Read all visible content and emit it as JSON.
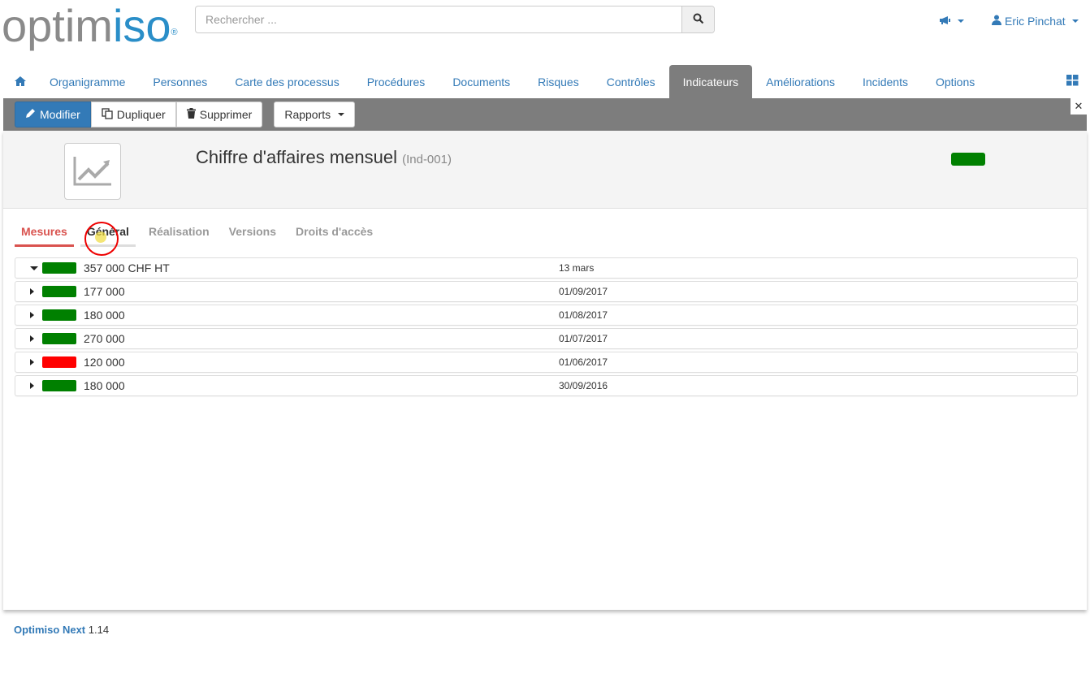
{
  "header": {
    "logo_gray": "optim",
    "logo_accent": "iso",
    "logo_reg": "®",
    "search_placeholder": "Rechercher ...",
    "user_name": "Eric Pinchat"
  },
  "nav": {
    "items": [
      {
        "label": "Organigramme"
      },
      {
        "label": "Personnes"
      },
      {
        "label": "Carte des processus"
      },
      {
        "label": "Procédures"
      },
      {
        "label": "Documents"
      },
      {
        "label": "Risques"
      },
      {
        "label": "Contrôles"
      },
      {
        "label": "Indicateurs"
      },
      {
        "label": "Améliorations"
      },
      {
        "label": "Incidents"
      },
      {
        "label": "Options"
      }
    ],
    "active_index": 7
  },
  "toolbar": {
    "edit_label": "Modifier",
    "duplicate_label": "Dupliquer",
    "delete_label": "Supprimer",
    "reports_label": "Rapports"
  },
  "indicator": {
    "title": "Chiffre d'affaires mensuel",
    "code": "(Ind-001)",
    "status_color": "#008000"
  },
  "tabs": [
    {
      "label": "Mesures"
    },
    {
      "label": "Général"
    },
    {
      "label": "Réalisation"
    },
    {
      "label": "Versions"
    },
    {
      "label": "Droits d'accès"
    }
  ],
  "measures": [
    {
      "value": "357 000 CHF HT",
      "date": "13 mars",
      "status_color": "#008000",
      "expanded": true
    },
    {
      "value": "177 000",
      "date": "01/09/2017",
      "status_color": "#008000",
      "expanded": false
    },
    {
      "value": "180 000",
      "date": "01/08/2017",
      "status_color": "#008000",
      "expanded": false
    },
    {
      "value": "270 000",
      "date": "01/07/2017",
      "status_color": "#008000",
      "expanded": false
    },
    {
      "value": "120 000",
      "date": "01/06/2017",
      "status_color": "#ff0000",
      "expanded": false
    },
    {
      "value": "180 000",
      "date": "30/09/2016",
      "status_color": "#008000",
      "expanded": false
    }
  ],
  "footer": {
    "brand": "Optimiso Next",
    "version": "1.14"
  },
  "colors": {
    "accent": "#337ab7",
    "active_tab": "#d9534f",
    "nav_active_bg": "#7d7d7d"
  }
}
